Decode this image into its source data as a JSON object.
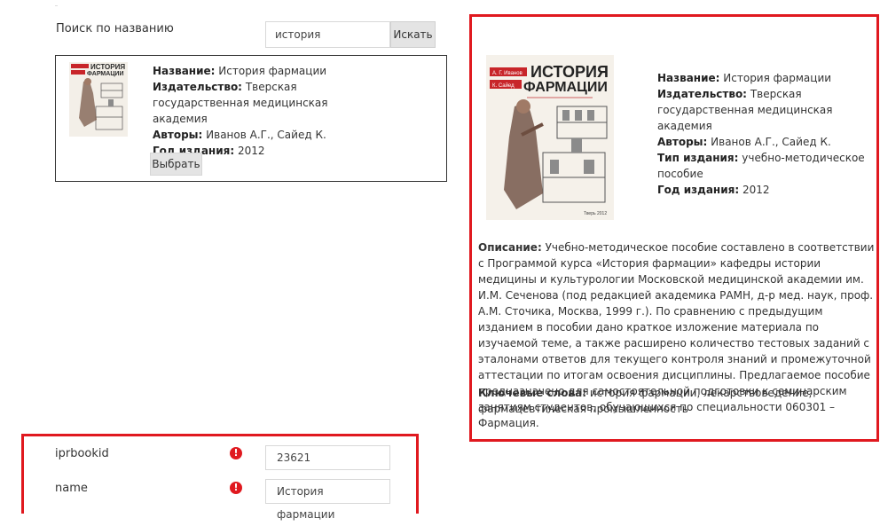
{
  "search": {
    "label": "Поиск по названию",
    "value": "история фармации",
    "button": "Искать"
  },
  "result": {
    "title_label": "Название:",
    "title": "История фармации",
    "publisher_label": "Издательство:",
    "publisher": "Тверская государственная медицинская академия",
    "authors_label": "Авторы:",
    "authors": "Иванов А.Г., Сайед К.",
    "year_label": "Год издания:",
    "year": "2012",
    "select_button": "Выбрать"
  },
  "details": {
    "cover": {
      "author1": "А. Г. Иванов",
      "author2": "К. Сайед",
      "title_line1": "ИСТОРИЯ",
      "title_line2": "ФАРМАЦИИ",
      "bottom": "Тверь 2012"
    },
    "title_label": "Название:",
    "title": "История фармации",
    "publisher_label": "Издательство:",
    "publisher": "Тверская государственная медицинская академия",
    "authors_label": "Авторы:",
    "authors": "Иванов А.Г., Сайед К.",
    "type_label": "Тип издания:",
    "type": "учебно-методическое пособие",
    "year_label": "Год издания:",
    "year": "2012",
    "description_label": "Описание:",
    "description": "Учебно-методическое пособие составлено в соответствии с Программой курса «История фармации» кафедры истории медицины и культурологии Московской медицинской академии им. И.М. Сеченова (под редакцией академика РАМН, д-р мед. наук, проф. А.М. Сточика, Москва, 1999 г.). По сравнению с предыдущим изданием в пособии дано краткое изложение материала по изучаемой теме, а также расширено количество тестовых заданий с эталонами ответов для текущего контроля знаний и промежуточной аттестации по итогам освоения дисциплины. Предлагаемое пособие предназначено для самостоятельной подготовки к семинарским занятиям студентов, обучающихся по специальности 060301 – Фармация.",
    "keywords_label": "Ключевые слова:",
    "keywords": "история фармации, лекарствоведение, фармацевтическая промышленность"
  },
  "fields": [
    {
      "label": "iprbookid",
      "value": "23621"
    },
    {
      "label": "name",
      "value": "История фармации"
    }
  ],
  "colors": {
    "highlight": "#e0191f",
    "button_bg": "#e4e4e4"
  }
}
